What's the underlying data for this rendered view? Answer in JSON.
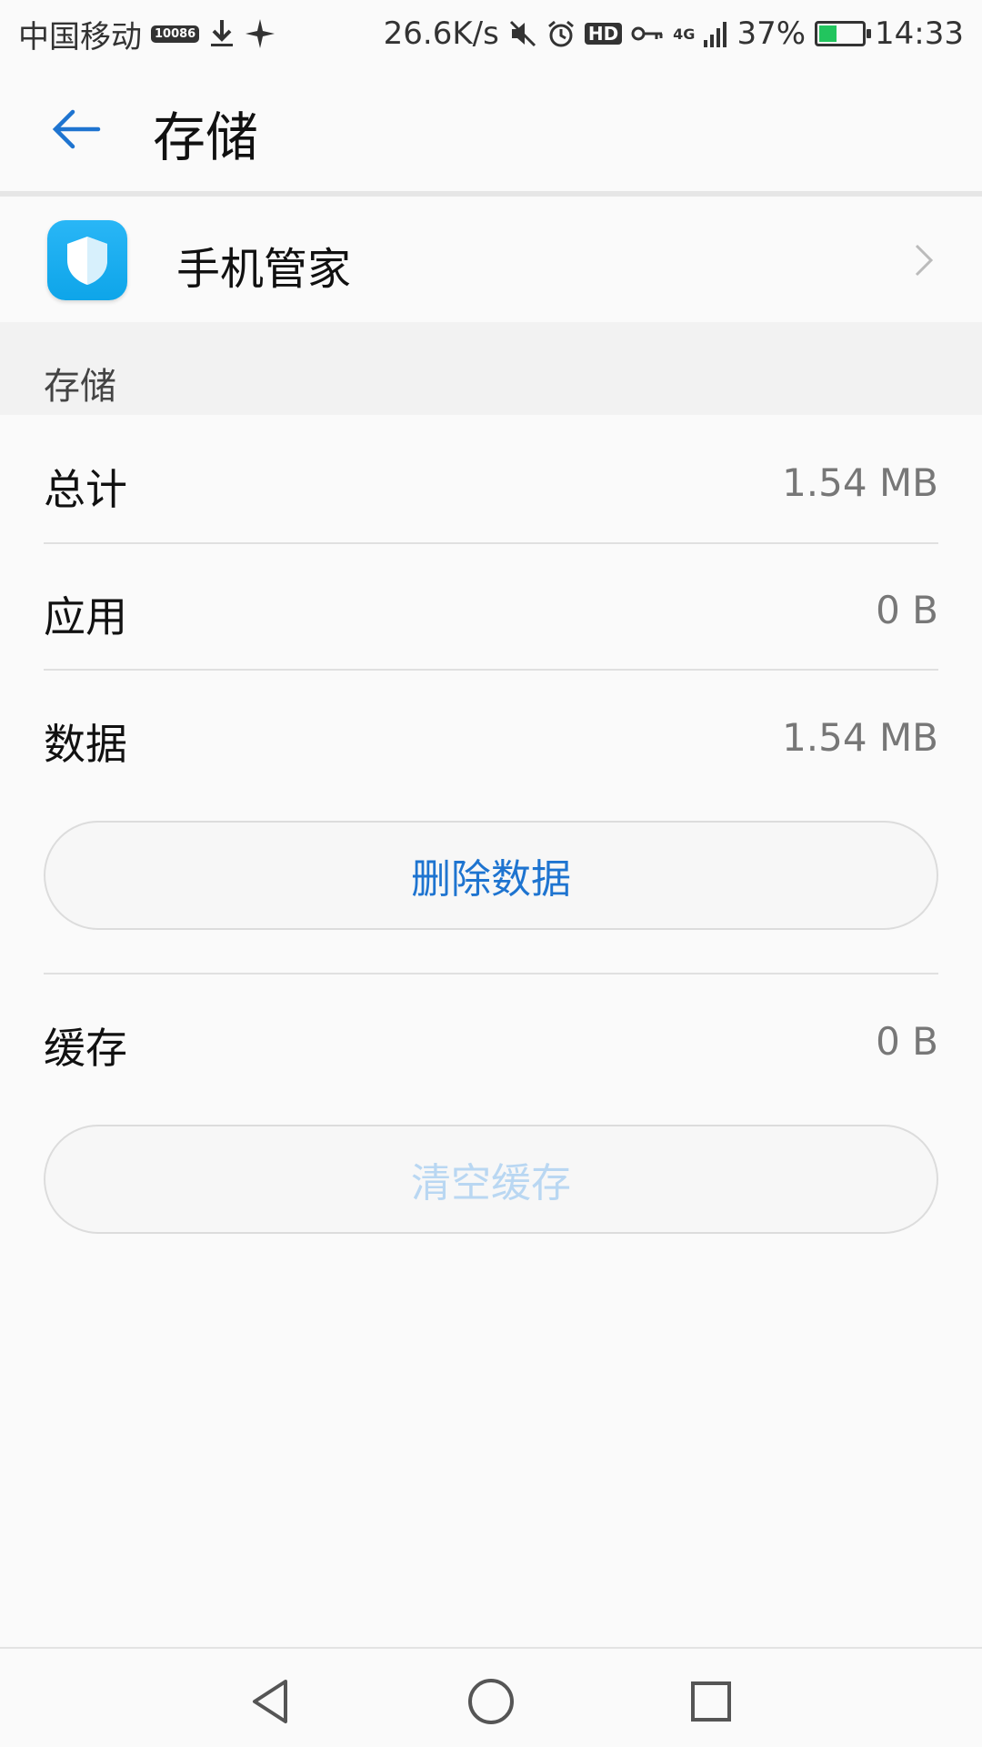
{
  "status_bar": {
    "carrier": "中国移动",
    "carrier_badge": "10086",
    "network_speed": "26.6K/s",
    "hd_badge": "HD",
    "network_type": "4G",
    "battery_percent": "37%",
    "battery_level": 0.37,
    "time": "14:33"
  },
  "header": {
    "title": "存储"
  },
  "app": {
    "name": "手机管家"
  },
  "section": {
    "title": "存储"
  },
  "storage": {
    "total_label": "总计",
    "total_value": "1.54 MB",
    "app_label": "应用",
    "app_value": "0 B",
    "data_label": "数据",
    "data_value": "1.54 MB",
    "clear_data_button": "删除数据",
    "cache_label": "缓存",
    "cache_value": "0 B",
    "clear_cache_button": "清空缓存"
  },
  "colors": {
    "accent": "#1e74d0",
    "disabled_accent": "#b9d7f2",
    "app_icon": "#0ea5e9"
  },
  "icons": {
    "back": "arrow-left-icon",
    "chevron": "chevron-right-icon",
    "nav_back": "triangle-back-icon",
    "nav_home": "circle-home-icon",
    "nav_recent": "square-recent-icon"
  }
}
